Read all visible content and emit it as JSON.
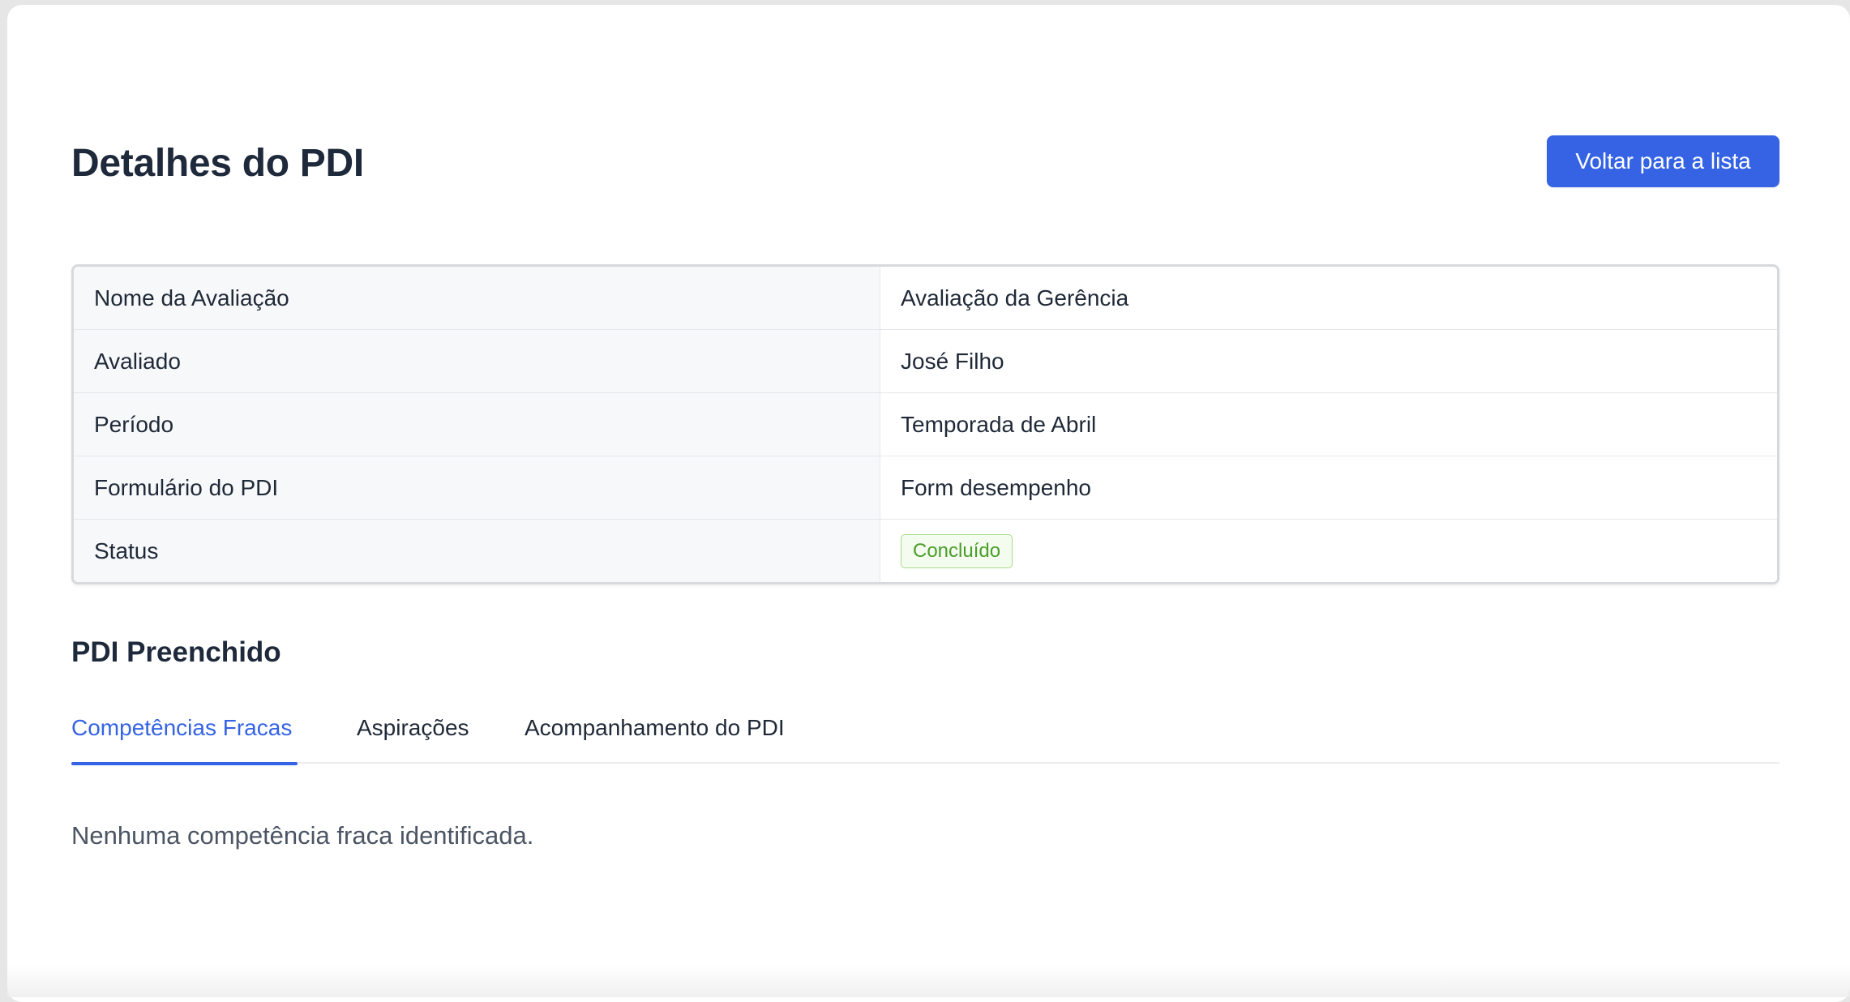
{
  "header": {
    "title": "Detalhes do PDI",
    "back_button_label": "Voltar para a lista"
  },
  "details": {
    "rows": [
      {
        "label": "Nome da Avaliação",
        "value": "Avaliação da Gerência"
      },
      {
        "label": "Avaliado",
        "value": "José Filho"
      },
      {
        "label": "Período",
        "value": "Temporada de Abril"
      },
      {
        "label": "Formulário do PDI",
        "value": "Form desempenho"
      },
      {
        "label": "Status",
        "value": "Concluído"
      }
    ]
  },
  "pdi": {
    "section_title": "PDI Preenchido",
    "tabs": [
      {
        "label": "Competências Fracas",
        "active": true
      },
      {
        "label": "Aspirações",
        "active": false
      },
      {
        "label": "Acompanhamento do PDI",
        "active": false
      }
    ],
    "empty_message": "Nenhuma competência fraca identificada."
  },
  "colors": {
    "primary": "#3563e4",
    "status_success_text": "#4a9e2a",
    "status_success_border": "#a6dc8a"
  }
}
